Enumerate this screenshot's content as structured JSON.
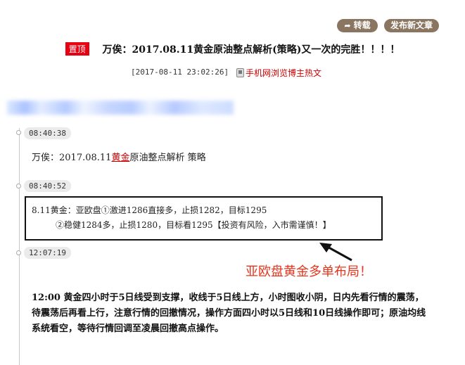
{
  "toolbar": {
    "repost_label": "转载",
    "new_post_label": "发布新文章",
    "accent_color": "#8a7560"
  },
  "post": {
    "pin_badge": "置顶",
    "title": "万俟：2017.08.11黄金原油整点解析(策略)又一次的完胜！！！！",
    "timestamp": "[2017-08-11 23:02:26]",
    "mobile_link": "手机网浏览博主热文"
  },
  "timeline": [
    {
      "time": "08:40:38",
      "text_before": "万俟：2017.08.11",
      "text_link": "黄金",
      "text_after": "原油整点解析 策略"
    },
    {
      "time": "08:40:52",
      "lines": [
        "8.11黄金：亚欧盘①激进1286直接多，止损1282，目标1295",
        "②稳健1284多，止损1280，目标看1295【投资有风险，入市需谨慎！】"
      ]
    },
    {
      "time": "12:07:19",
      "text": "12:00 黄金四小时于5日线受到支撑，收线于5日线上方，小时图收小阴，日内先看行情的震荡，待震荡后再看上行，注意行情的回撤情况，操作方面四小时以5日线和10日线操作即可；原油均线系统看空，等待行情回调至凌晨回撤高点操作。"
    }
  ],
  "annotation": {
    "callout": "亚欧盘黄金多单布局！",
    "color": "#e8341c"
  }
}
